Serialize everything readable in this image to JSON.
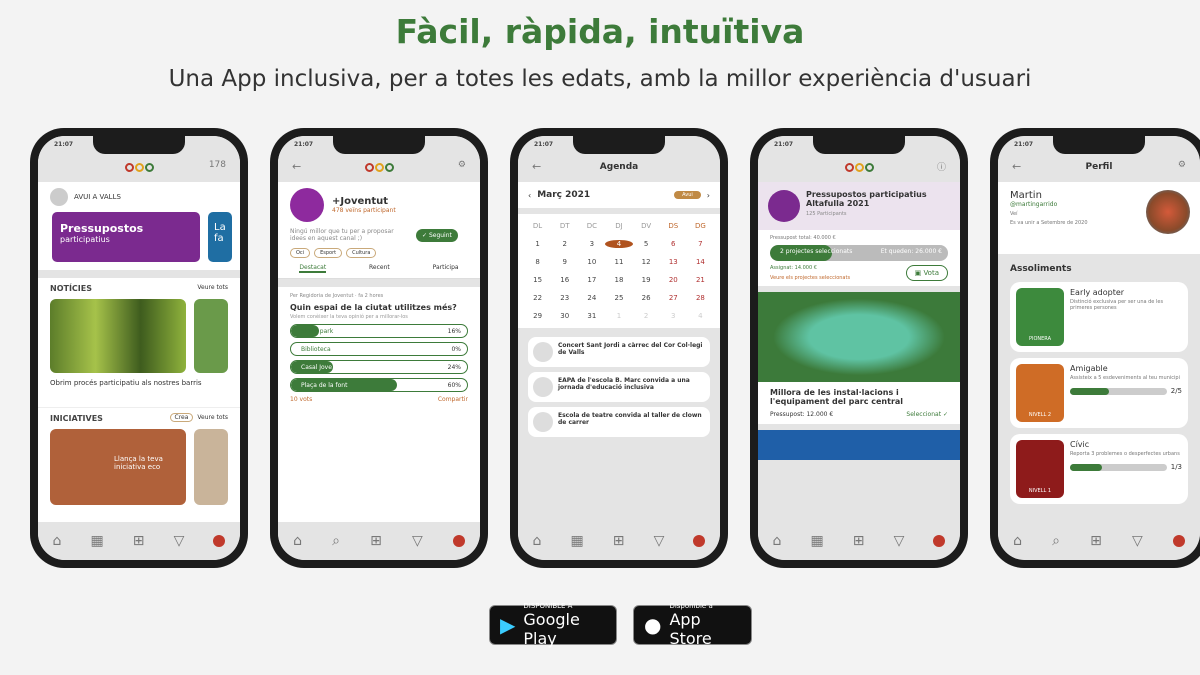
{
  "headline": "Fàcil, ràpida, intuïtiva",
  "subheadline": "Una App inclusiva, per a totes les edats, amb la millor experiència d'usuari",
  "colors": {
    "accent_green": "#3d7b3a",
    "purple": "#7b2a8f",
    "orange": "#c0692e",
    "dark_red": "#8e1b1b"
  },
  "status_time": "21:07",
  "phone1": {
    "coins": "178",
    "town": "AVUI A VALLS",
    "banner_title": "Pressupostos",
    "banner_sub": "participatius",
    "banner2": "La fa",
    "news_title": "NOTÍCIES",
    "see_all": "Veure tots",
    "news_caption": "Obrim procés participatiu als nostres barris",
    "init_title": "INICIATIVES",
    "init_tag": "Crea",
    "init_card": "Llança la teva iniciativa eco"
  },
  "phone2": {
    "channel": "+Joventut",
    "participants": "478 veïns participant",
    "desc": "Ningú millor que tu per a proposar idees en aquest canal ;)",
    "follow": "Seguint",
    "tags": [
      "Oci",
      "Esport",
      "Cultura"
    ],
    "tabs": [
      "Destacat",
      "Recent",
      "Participa"
    ],
    "author": "Per Regidoria de Joventut · fa 2 hores",
    "question": "Quin espai de la ciutat utilitzes més?",
    "question_sub": "Volem conèixer la teva opinió per a millorar-los",
    "options": [
      {
        "label": "Skate park",
        "pct": 16
      },
      {
        "label": "Biblioteca",
        "pct": 0
      },
      {
        "label": "Casal Jove",
        "pct": 24
      },
      {
        "label": "Plaça de la font",
        "pct": 60
      }
    ],
    "votes": "10 vots",
    "share": "Compartir"
  },
  "phone3": {
    "title": "Agenda",
    "month": "Març 2021",
    "today_btn": "Avui",
    "weekdays": [
      "DL",
      "DT",
      "DC",
      "DJ",
      "DV",
      "DS",
      "DG"
    ],
    "days": [
      "1",
      "2",
      "3",
      "4",
      "5",
      "6",
      "7",
      "8",
      "9",
      "10",
      "11",
      "12",
      "13",
      "14",
      "15",
      "16",
      "17",
      "18",
      "19",
      "20",
      "21",
      "22",
      "23",
      "24",
      "25",
      "26",
      "27",
      "28",
      "29",
      "30",
      "31",
      "1",
      "2",
      "3",
      "4"
    ],
    "selected_day": "4",
    "events": [
      {
        "title": "Concert Sant Jordi a càrrec del Cor Col·legi de Valls"
      },
      {
        "title": "EAPA de l'escola B. Marc convida a una jornada d'educació inclusiva"
      },
      {
        "title": "Escola de teatre convida al taller de clown de carrer"
      }
    ]
  },
  "phone4": {
    "title": "Pressupostos participatius Altafulla 2021",
    "participants": "125 Participants",
    "total": "Pressupost total: 40.000 €",
    "selected": "2 projectes seleccionats",
    "remaining": "Et queden: 26.000 €",
    "assigned": "Assignat: 14.000 €",
    "view_selected": "Veure els projectes seleccionats",
    "vote": "Vota",
    "assigned_fraction": 0.35,
    "project_title": "Millora de les instal·lacions i l'equipament del parc central",
    "project_budget": "Pressupost: 12.000 €",
    "project_status": "Seleccionat"
  },
  "phone5": {
    "title": "Perfil",
    "name": "Martin",
    "handle": "@martingarrido",
    "role": "Veí",
    "joined": "Es va unir a Setembre de 2020",
    "achievements_title": "Assoliments",
    "achievements": [
      {
        "name": "Early adopter",
        "desc": "Distinció exclusiva per ser una de les primeres persones",
        "level": "PIONERA",
        "color": "#3d8a3d"
      },
      {
        "name": "Amigable",
        "desc": "Assisteix a 5 esdeveniments al teu municipi",
        "level": "NIVELL 2",
        "progress": "2/5",
        "fraction": 0.4,
        "color": "#cf6c26"
      },
      {
        "name": "Cívic",
        "desc": "Reporta 3 problemes o desperfectes urbans",
        "level": "NIVELL 1",
        "progress": "1/3",
        "fraction": 0.33,
        "color": "#8e1b1b"
      }
    ]
  },
  "stores": {
    "google_small": "DISPONIBLE A",
    "google": "Google Play",
    "apple_small": "Disponible a",
    "apple": "App Store"
  }
}
